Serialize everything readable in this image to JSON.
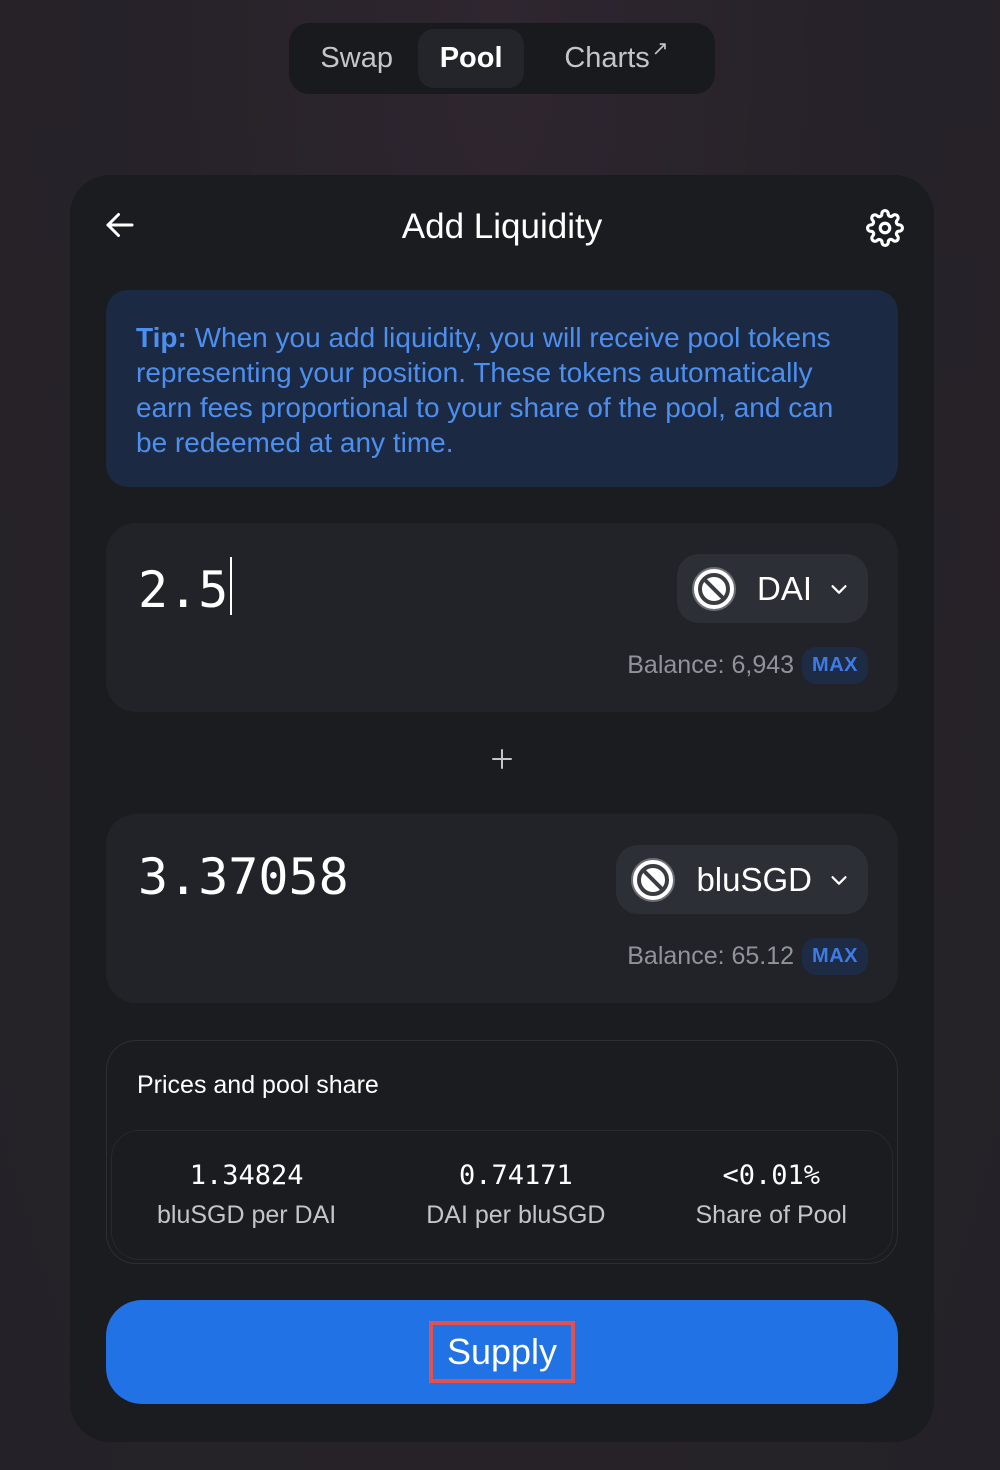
{
  "nav": {
    "swap": "Swap",
    "pool": "Pool",
    "charts": "Charts",
    "charts_ext": "↗"
  },
  "card": {
    "title": "Add Liquidity"
  },
  "tip": {
    "label": "Tip:",
    "text": " When you add liquidity, you will receive pool tokens representing your position. These tokens automatically earn fees proportional to your share of the pool, and can be redeemed at any time."
  },
  "input_a": {
    "amount": "2.5",
    "token": "DAI",
    "balance": "Balance: 6,943",
    "max_label": "MAX"
  },
  "input_b": {
    "amount": "3.37058",
    "token": "bluSGD",
    "balance": "Balance: 65.12",
    "max_label": "MAX"
  },
  "prices": {
    "title": "Prices and pool share",
    "stats": [
      {
        "value": "1.34824",
        "label": "bluSGD per DAI"
      },
      {
        "value": "0.74171",
        "label": "DAI per bluSGD"
      },
      {
        "value": "<0.01%",
        "label": "Share of Pool"
      }
    ]
  },
  "supply_label": "Supply",
  "colors": {
    "accent": "#2172e5",
    "tip_text": "#4d8ff0",
    "highlight_box": "#e0524f"
  }
}
